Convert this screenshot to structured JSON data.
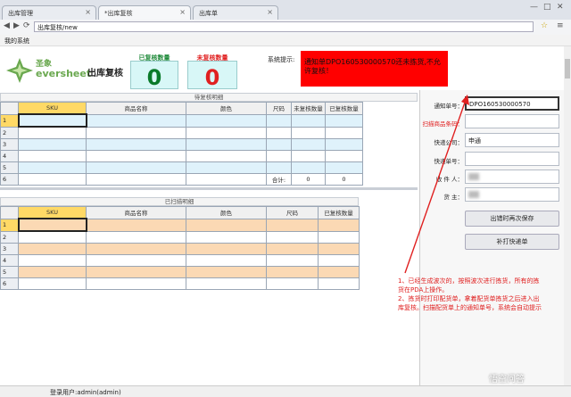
{
  "tabs": [
    {
      "label": "出库管理"
    },
    {
      "label": "*出库复核"
    },
    {
      "label": "出库单"
    }
  ],
  "address": {
    "url": "出库复核/new"
  },
  "menubar": {
    "label": "我的系统"
  },
  "header": {
    "brand_cn": "圣象",
    "brand_en": "eversheet",
    "page_title": "出库复核",
    "checked_label": "已复核数量",
    "checked_value": "0",
    "unchecked_label": "未复核数量",
    "unchecked_value": "0",
    "sys_tip_label": "系统提示:",
    "alert_text": "通知单DPO160530000570还未拣货,不允许复核！"
  },
  "colors": {
    "accent_green": "#1f8a3a",
    "alert_red": "#ff0000",
    "count_green": "#0a7a2a",
    "count_red": "#e02020"
  },
  "pending_grid": {
    "title": "待复核明细",
    "columns": [
      "SKU",
      "商品名称",
      "颜色",
      "尺码",
      "未复核数量",
      "已复核数量"
    ],
    "row_numbers": [
      "1",
      "2",
      "3",
      "4",
      "5",
      "6"
    ],
    "total_label": "合计:",
    "total_unchecked": "0",
    "total_checked": "0"
  },
  "scanned_grid": {
    "title": "已扫描明细",
    "columns": [
      "SKU",
      "商品名称",
      "颜色",
      "尺码",
      "已复核数量"
    ],
    "row_numbers": [
      "1",
      "2",
      "3",
      "4",
      "5",
      "6"
    ]
  },
  "right_panel": {
    "notice_label": "通知单号：",
    "notice_value": "DPO160530000570",
    "scan_label": "扫描商品条码：",
    "courier_label": "快递公司：",
    "courier_value": "申通",
    "tracking_label": "快递单号：",
    "receiver_label": "收 件 人：",
    "owner_label": "货    主：",
    "save_button": "出错时再次保存",
    "reprint_button": "补打快递单"
  },
  "annotation": {
    "line1": "1、已经生成波次的，按照波次进行拣货，所有的拣",
    "line2": "货在PDA上操作。",
    "line3": "2、拣货时打印配货单，拿着配货单拣货之后进入出",
    "line4": "库复核。扫描配货单上的通知单号，系统会自动提示"
  },
  "watermark": {
    "text": "悟空问答"
  },
  "status": {
    "user": "登录用户:admin(admin)"
  }
}
